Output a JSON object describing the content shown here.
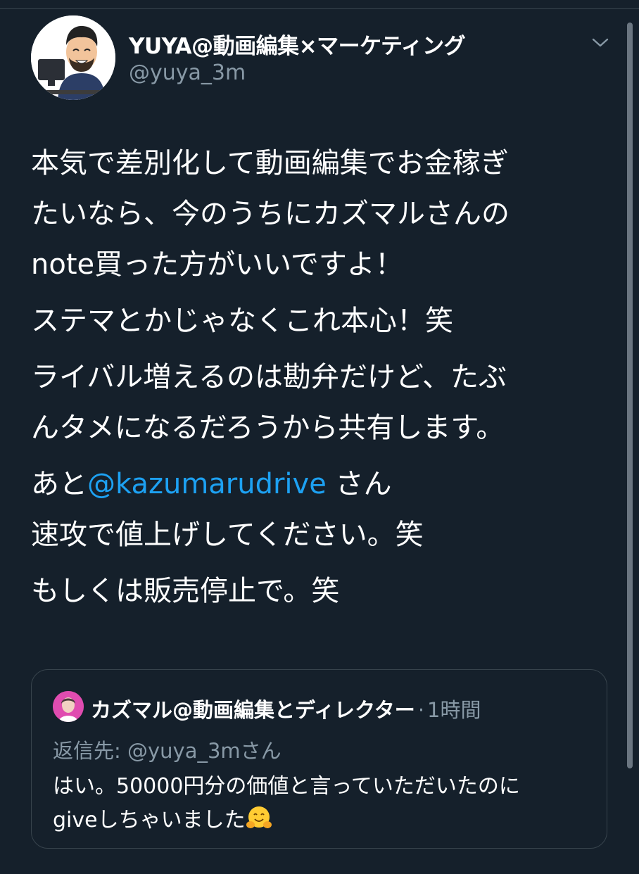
{
  "header": {
    "display_name": "YUYA@動画編集×マーケティング",
    "handle": "@yuya_3m"
  },
  "tweet": {
    "line1": "本気で差別化して動画編集でお金稼ぎ",
    "line2": "たいなら、今のうちにカズマルさんの",
    "line3": "note買った方がいいですよ！",
    "para2": "ステマとかじゃなくこれ本心！笑",
    "para3_line1": "ライバル増えるのは勘弁だけど、たぶ",
    "para3_line2": "んタメになるだろうから共有します。",
    "para4_prefix": "あと",
    "para4_mention": "@kazumarudrive",
    "para4_suffix": " さん",
    "para4_line2": "速攻で値上げしてください。笑",
    "para5": "もしくは販売停止で。笑"
  },
  "quote": {
    "name": "カズマル@動画編集とディレクター",
    "separator": "·",
    "time": "1時間",
    "reply_to": "返信先: @yuya_3mさん",
    "text_line1": "はい。50000円分の価値と言っていただいたのに",
    "text_line2": "giveしちゃいました"
  },
  "icons": {
    "menu": "chevron-down-icon",
    "emoji": "hugging-face-emoji-icon"
  },
  "colors": {
    "background": "#15202b",
    "text": "#ffffff",
    "secondary": "#8899a6",
    "link": "#1da1f2",
    "border": "#38444d"
  }
}
